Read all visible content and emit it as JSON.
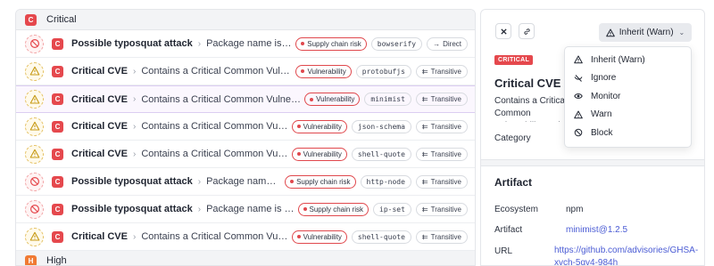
{
  "colors": {
    "critical": "#e5484d",
    "high": "#f07a33",
    "warn": "#e4c060",
    "link": "#4a5bd4"
  },
  "groups": {
    "critical": {
      "badge": "C",
      "label": "Critical"
    },
    "high": {
      "badge": "H",
      "label": "High"
    }
  },
  "alerts": [
    {
      "action_icon": "block-icon",
      "severity": "C",
      "title": "Possible typosquat attack",
      "description": "Package name is similar to ...",
      "type": "Supply chain risk",
      "package": "bowserify",
      "dep_icon": "arrow-right-icon",
      "dep_symbol": "→",
      "dependency": "Direct"
    },
    {
      "action_icon": "warn-icon",
      "severity": "C",
      "title": "Critical CVE",
      "description": "Contains a Critical Common Vulnerability ...",
      "type": "Vulnerability",
      "package": "protobufjs",
      "dep_icon": "transitive-icon",
      "dep_symbol": "⇇",
      "dependency": "Transitive"
    },
    {
      "action_icon": "warn-icon",
      "severity": "C",
      "title": "Critical CVE",
      "description": "Contains a Critical Common Vulnerability an...",
      "type": "Vulnerability",
      "package": "minimist",
      "dep_icon": "transitive-icon",
      "dep_symbol": "⇇",
      "dependency": "Transitive"
    },
    {
      "action_icon": "warn-icon",
      "severity": "C",
      "title": "Critical CVE",
      "description": "Contains a Critical Common Vulnerability...",
      "type": "Vulnerability",
      "package": "json-schema",
      "dep_icon": "transitive-icon",
      "dep_symbol": "⇇",
      "dependency": "Transitive"
    },
    {
      "action_icon": "warn-icon",
      "severity": "C",
      "title": "Critical CVE",
      "description": "Contains a Critical Common Vulnerability...",
      "type": "Vulnerability",
      "package": "shell-quote",
      "dep_icon": "transitive-icon",
      "dep_symbol": "⇇",
      "dependency": "Transitive"
    },
    {
      "action_icon": "block-icon",
      "severity": "C",
      "title": "Possible typosquat attack",
      "description": "Package name is similar ...",
      "type": "Supply chain risk",
      "package": "http-node",
      "dep_icon": "transitive-icon",
      "dep_symbol": "⇇",
      "dependency": "Transitive"
    },
    {
      "action_icon": "block-icon",
      "severity": "C",
      "title": "Possible typosquat attack",
      "description": "Package name is similar to ...",
      "type": "Supply chain risk",
      "package": "ip-set",
      "dep_icon": "transitive-icon",
      "dep_symbol": "⇇",
      "dependency": "Transitive"
    },
    {
      "action_icon": "warn-icon",
      "severity": "C",
      "title": "Critical CVE",
      "description": "Contains a Critical Common Vulnerability...",
      "type": "Vulnerability",
      "package": "shell-quote",
      "dep_icon": "transitive-icon",
      "dep_symbol": "⇇",
      "dependency": "Transitive"
    }
  ],
  "detail": {
    "action_button": "Inherit (Warn)",
    "severity_badge": "CRITICAL",
    "title": "Critical CVE",
    "description": "Contains a Critical Common Vulnerability and Exposure (CVE).",
    "category_label": "Category",
    "artifact_heading": "Artifact",
    "fields": {
      "ecosystem_label": "Ecosystem",
      "ecosystem_value": "npm",
      "artifact_label": "Artifact",
      "artifact_value": "minimist@1.2.5",
      "url_label": "URL",
      "url_value": "https://github.com/advisories/GHSA-xvch-5gv4-984h"
    }
  },
  "dropdown": {
    "items": [
      {
        "icon": "warn-icon",
        "label": "Inherit (Warn)"
      },
      {
        "icon": "ignore-icon",
        "label": "Ignore"
      },
      {
        "icon": "monitor-icon",
        "label": "Monitor"
      },
      {
        "icon": "warn-icon",
        "label": "Warn"
      },
      {
        "icon": "block-icon",
        "label": "Block"
      }
    ]
  }
}
